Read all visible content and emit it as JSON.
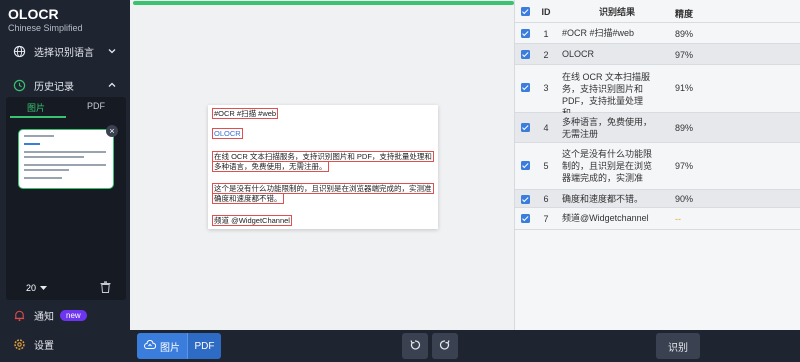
{
  "app": {
    "title": "OLOCR",
    "language": "Chinese Simplified"
  },
  "sidebar": {
    "lang_select_label": "选择识别语言",
    "history_label": "历史记录",
    "tabs": [
      {
        "label": "图片"
      },
      {
        "label": "PDF"
      }
    ],
    "page_size": "20",
    "notify_label": "通知",
    "notify_badge": "new",
    "settings_label": "设置"
  },
  "toolbar": {
    "image_button": "图片",
    "pdf_button": "PDF",
    "recognize_button": "识别"
  },
  "document": {
    "lines": [
      "#OCR #扫描 #web",
      "OLOCR",
      "在线 OCR 文本扫描服务，支持识别图片和 PDF，支持批量处理和",
      "多种语言，免费使用，无需注册。",
      "这个是没有什么功能限制的，且识别是在浏览器端完成的，实测准",
      "确度和速度都不错。",
      "频道 @WidgetChannel"
    ]
  },
  "table": {
    "headers": {
      "id": "ID",
      "result": "识别结果",
      "accuracy": "精度"
    },
    "rows": [
      {
        "id": "1",
        "text": "#OCR #扫描#web",
        "accuracy": "89%"
      },
      {
        "id": "2",
        "text": "OLOCR",
        "accuracy": "97%"
      },
      {
        "id": "3",
        "text": "在线 OCR 文本扫描服务，支持识别图片和PDF，支持批量处理和",
        "accuracy": "91%"
      },
      {
        "id": "4",
        "text": "多种语言，免费使用，无需注册",
        "accuracy": "89%"
      },
      {
        "id": "5",
        "text": "这个是没有什么功能限制的，且识别是在浏览器端完成的，实测准",
        "accuracy": "97%"
      },
      {
        "id": "6",
        "text": "确度和速度都不错。",
        "accuracy": "90%"
      },
      {
        "id": "7",
        "text": "频道@Widgetchannel",
        "accuracy": "--"
      }
    ]
  },
  "colors": {
    "accent_green": "#39c270",
    "accent_blue": "#3b7ddd",
    "sidebar_bg": "#1e2430",
    "low_accuracy": "#f0a020"
  },
  "progress": 1.0
}
